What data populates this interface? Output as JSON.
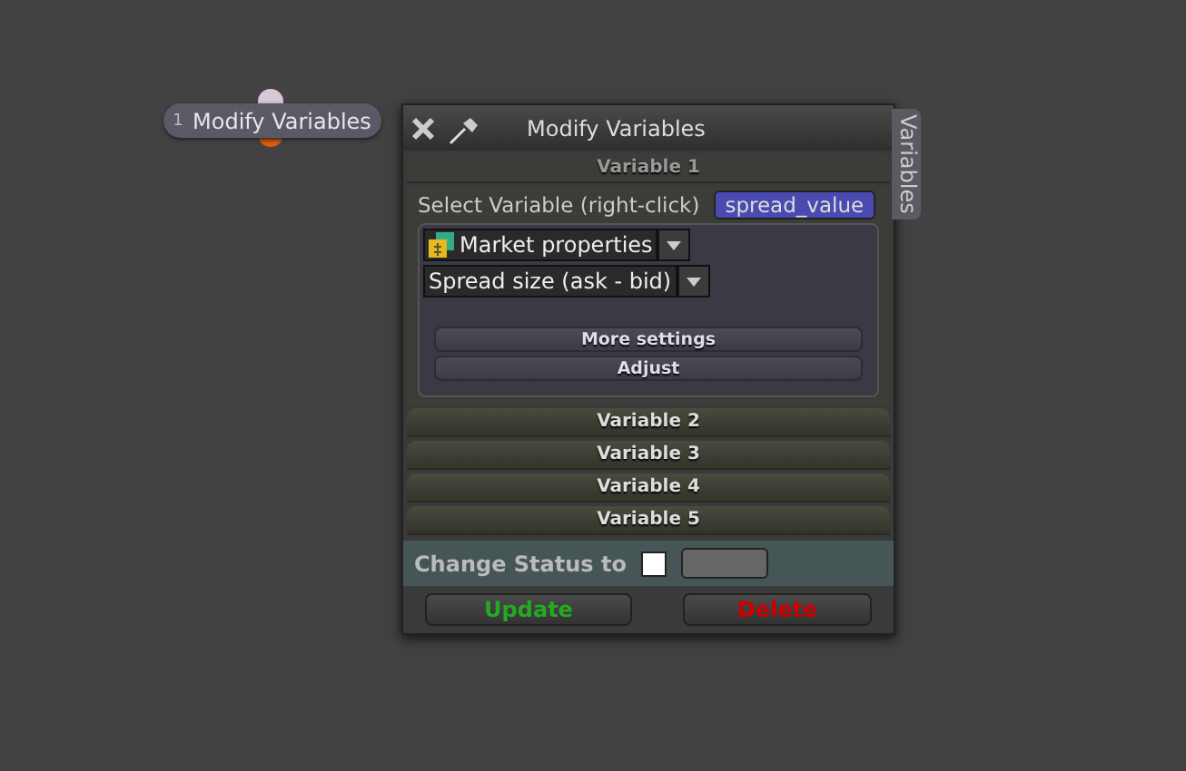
{
  "node": {
    "index": "1",
    "label": "Modify Variables"
  },
  "window": {
    "title": "Modify Variables",
    "side_tab": "Variables"
  },
  "variables": [
    {
      "title": "Variable 1",
      "expanded": true,
      "select_label": "Select Variable (right-click)",
      "variable": "spread_value",
      "category": "Market properties",
      "property": "Spread size (ask - bid)",
      "buttons": [
        "More settings",
        "Adjust"
      ]
    },
    {
      "title": "Variable 2",
      "expanded": false
    },
    {
      "title": "Variable 3",
      "expanded": false
    },
    {
      "title": "Variable 4",
      "expanded": false
    },
    {
      "title": "Variable 5",
      "expanded": false
    }
  ],
  "status": {
    "label": "Change Status to",
    "checked": false
  },
  "actions": [
    {
      "label": "Update",
      "kind": "update"
    },
    {
      "label": "Delete",
      "kind": "delete"
    }
  ]
}
